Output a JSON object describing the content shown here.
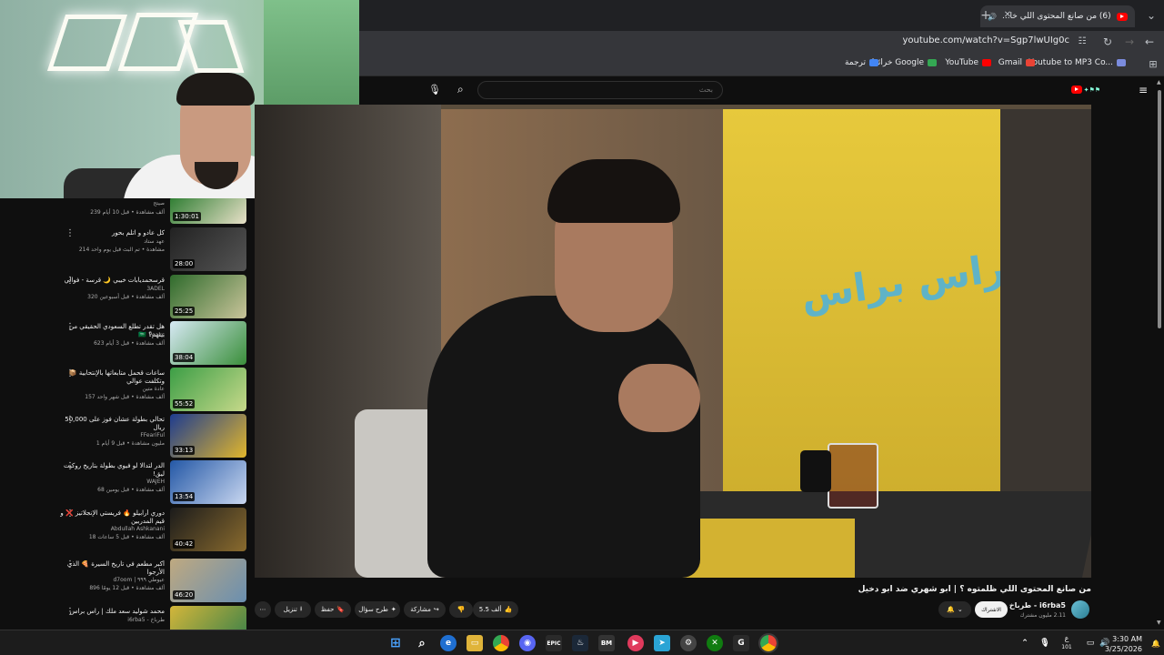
{
  "browser": {
    "tab_title": "(6) من صانع المحتوى اللي خا...",
    "url": "youtube.com/watch?v=Sgp7lwUIg0c",
    "bookmarks": [
      {
        "label": "Youtube to MP3 Co...",
        "color": "#7b8cde"
      },
      {
        "label": "Gmail",
        "color": "#ea4335"
      },
      {
        "label": "YouTube",
        "color": "#ff0000"
      },
      {
        "label": "خرائط Google",
        "color": "#34a853"
      },
      {
        "label": "ترجمة",
        "color": "#4285f4"
      }
    ]
  },
  "search": {
    "placeholder": "بحث"
  },
  "video": {
    "title": "من صانع المحتوى اللي ظلمتوه ؟ | ابو شهري ضد ابو دخيل",
    "channel": "i6rba5 - طرباخ",
    "subscribers": "2.11 مليون مشترك",
    "subscribe_label": "الاشتراك",
    "likes": "5.5 ألف",
    "share_label": "مشاركة",
    "ask_label": "طرح سؤال",
    "save_label": "حفظ",
    "download_label": "تنزيل",
    "set_text": "راس براس"
  },
  "recommendations": [
    {
      "title": "",
      "channel": "صيتح",
      "meta": "239 ألف مشاهدة • قبل 10 أيام",
      "duration": "1:30:01",
      "colors": [
        "#2e7d32",
        "#e8e0c8"
      ]
    },
    {
      "title": "كل عادو و اتلم بحور",
      "channel": "عهد ستاد",
      "meta": "214 مشاهدة • تم البث قبل يوم واحد",
      "duration": "28:00",
      "colors": [
        "#222",
        "#555"
      ]
    },
    {
      "title": "قرسحمديابات خيبي 🌙 قرسة - فوالي",
      "channel": "3ADEL",
      "meta": "320 ألف مشاهدة • قبل أسبوعين",
      "duration": "25:25",
      "colors": [
        "#2f6b2c",
        "#c9c49a"
      ]
    },
    {
      "title": "هل تقدر تطلع السعودي الحقيقي من بينهم؟ 🇸🇦",
      "channel": "Peaks",
      "meta": "623 ألف مشاهدة • قبل 3 أيام",
      "duration": "38:04",
      "colors": [
        "#d7e9f5",
        "#3a8f3a"
      ]
    },
    {
      "title": "ساعات قحمل متابعاتها بالإنتحابية 📦 وتكلفت عوالي",
      "channel": "عادة متين",
      "meta": "157 ألف مشاهدة • قبل شهر واحد",
      "duration": "55:52",
      "colors": [
        "#3c9e46",
        "#c7d98a"
      ]
    },
    {
      "title": "تحالي بطولة عشان فوز على 50,000 ريال",
      "channel": "FFeariFul",
      "meta": "1 مليون مشاهدة • قبل 9 أيام",
      "duration": "33:13",
      "colors": [
        "#1e3c8f",
        "#e1b62c"
      ]
    },
    {
      "title": "الدر لتدالا لو فيوي بطولة بتاريخ روكيت ليق!",
      "channel": "WAJEH",
      "meta": "68 ألف مشاهدة • قبل يومين",
      "duration": "13:54",
      "colors": [
        "#2458a6",
        "#c9d7f0"
      ]
    },
    {
      "title": "دوري أرابيلو 🔥 فريستي الإنجلاتيز ❌ و قيم المدربين",
      "channel": "Abdullah Ashkanani",
      "meta": "18 ألف مشاهدة • قبل 5 ساعات",
      "duration": "40:42",
      "colors": [
        "#1b1b1b",
        "#8a6b2e"
      ]
    },
    {
      "title": "أكبر مطعم في تاريخ السيرة 🍕 الذي الأرجوا",
      "channel": "d7oom | عيوطي ٩٩٩",
      "meta": "896 ألف مشاهدة • قبل 12 يومًا",
      "duration": "46:20",
      "colors": [
        "#bfa980",
        "#6a8fb0"
      ]
    },
    {
      "title": "محمد شوليد سعد ملك | راس براس",
      "channel": "i6rba5 - طرباخ",
      "meta": "",
      "duration": "",
      "colors": [
        "#d4b63a",
        "#2f7d4a"
      ]
    }
  ],
  "taskbar": {
    "time": "3:30 AM",
    "date": "3/25/2026",
    "lang": "ع",
    "lang_sub": "101"
  }
}
